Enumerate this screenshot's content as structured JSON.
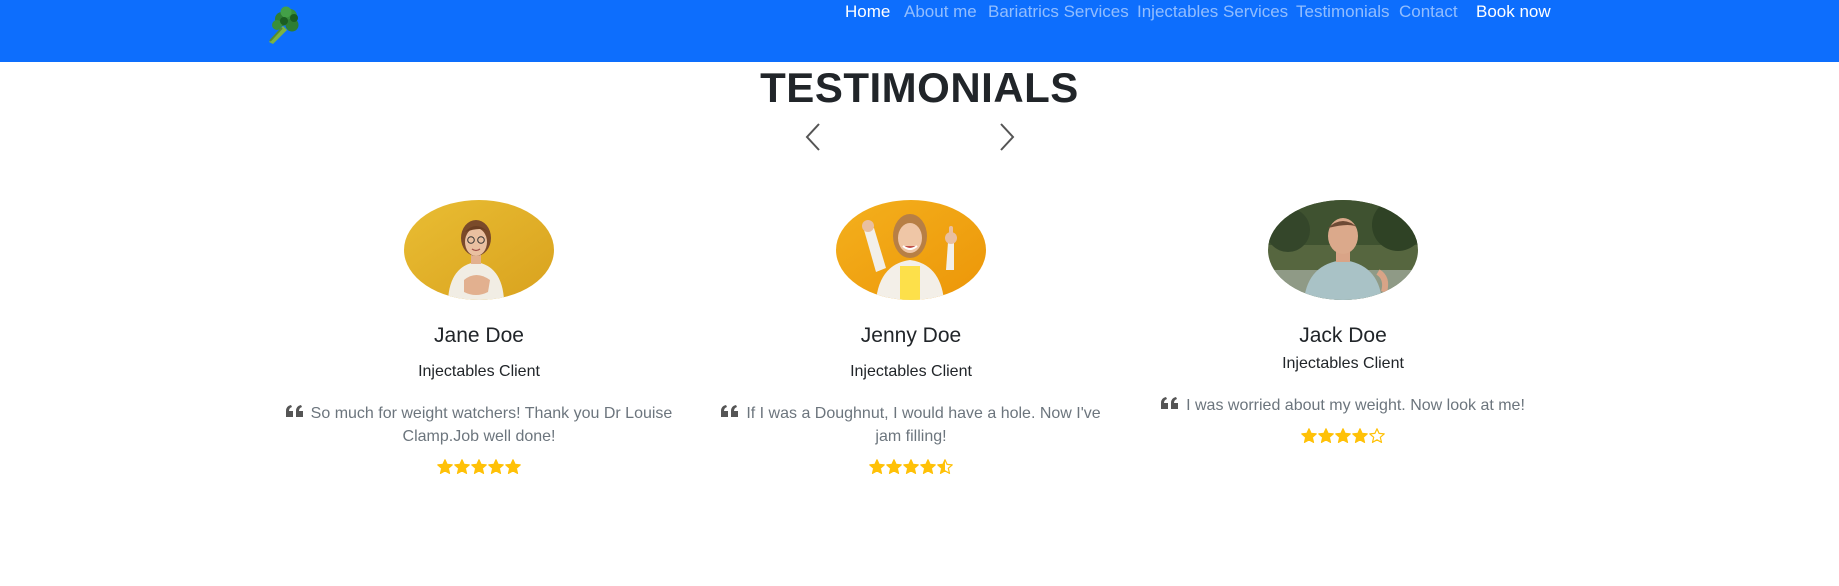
{
  "nav": {
    "brand_icon": "broccoli-icon",
    "links": [
      {
        "label": "Home",
        "active": true
      },
      {
        "label": "About me",
        "active": false
      },
      {
        "label": "Bariatrics Services",
        "active": false
      },
      {
        "label": "Injectables Services",
        "active": false
      },
      {
        "label": "Testimonials",
        "active": false
      },
      {
        "label": "Contact",
        "active": false
      }
    ],
    "book_label": "Book now",
    "colors": {
      "bar": "#0d6efd",
      "active": "#ffffff",
      "inactive": "rgba(255,255,255,0.55)"
    }
  },
  "section": {
    "title": "TESTIMONIALS",
    "prev_icon": "chevron-left-icon",
    "next_icon": "chevron-right-icon"
  },
  "testimonials": [
    {
      "name": "Jane Doe",
      "role": "Injectables Client",
      "quote": "So much for weight watchers! Thank you Dr Louise Clamp.Job well done!",
      "rating": 5,
      "photo": "woman-hand-on-heart-photo",
      "photo_bg": "#e8b82a"
    },
    {
      "name": "Jenny Doe",
      "role": "Injectables Client",
      "quote": "If I was a Doughnut, I would have a hole. Now I've jam filling!",
      "rating": 4.5,
      "photo": "woman-thumbs-up-photo",
      "photo_bg": "#f1a313"
    },
    {
      "name": "Jack Doe",
      "role": "Injectables Client",
      "quote": "I was worried about my weight. Now look at me!",
      "rating": 4,
      "photo": "man-in-park-photo",
      "photo_bg": "#4a5a3c"
    }
  ],
  "star_color": "#ffc107"
}
